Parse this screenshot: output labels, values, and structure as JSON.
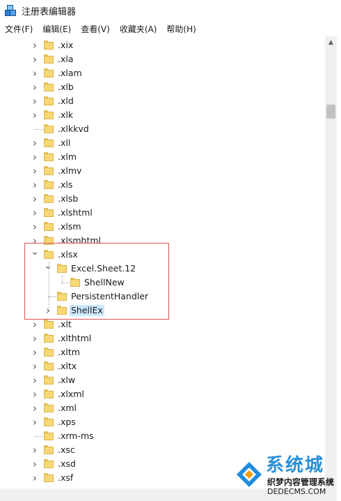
{
  "window": {
    "title": "注册表编辑器"
  },
  "menu": [
    {
      "label": "文件(F)"
    },
    {
      "label": "编辑(E)"
    },
    {
      "label": "查看(V)"
    },
    {
      "label": "收藏夹(A)"
    },
    {
      "label": "帮助(H)"
    }
  ],
  "tree": {
    "rows": [
      {
        "label": ".xix",
        "level": 0,
        "expander": "collapsed"
      },
      {
        "label": ".xla",
        "level": 0,
        "expander": "collapsed"
      },
      {
        "label": ".xlam",
        "level": 0,
        "expander": "collapsed"
      },
      {
        "label": ".xlb",
        "level": 0,
        "expander": "collapsed"
      },
      {
        "label": ".xld",
        "level": 0,
        "expander": "collapsed"
      },
      {
        "label": ".xlk",
        "level": 0,
        "expander": "collapsed"
      },
      {
        "label": ".xlkkvd",
        "level": 0,
        "expander": "none"
      },
      {
        "label": ".xll",
        "level": 0,
        "expander": "collapsed"
      },
      {
        "label": ".xlm",
        "level": 0,
        "expander": "collapsed"
      },
      {
        "label": ".xlmv",
        "level": 0,
        "expander": "collapsed"
      },
      {
        "label": ".xls",
        "level": 0,
        "expander": "collapsed"
      },
      {
        "label": ".xlsb",
        "level": 0,
        "expander": "collapsed"
      },
      {
        "label": ".xlshtml",
        "level": 0,
        "expander": "collapsed"
      },
      {
        "label": ".xlsm",
        "level": 0,
        "expander": "collapsed"
      },
      {
        "label": ".xlsmhtml",
        "level": 0,
        "expander": "collapsed"
      },
      {
        "label": ".xlsx",
        "level": 0,
        "expander": "expanded"
      },
      {
        "label": "Excel.Sheet.12",
        "level": 1,
        "expander": "expanded"
      },
      {
        "label": "ShellNew",
        "level": 2,
        "expander": "none"
      },
      {
        "label": "PersistentHandler",
        "level": 1,
        "expander": "none"
      },
      {
        "label": "ShellEx",
        "level": 1,
        "expander": "collapsed",
        "selected": true
      },
      {
        "label": ".xlt",
        "level": 0,
        "expander": "collapsed"
      },
      {
        "label": ".xlthtml",
        "level": 0,
        "expander": "collapsed"
      },
      {
        "label": ".xltm",
        "level": 0,
        "expander": "collapsed"
      },
      {
        "label": ".xltx",
        "level": 0,
        "expander": "collapsed"
      },
      {
        "label": ".xlw",
        "level": 0,
        "expander": "collapsed"
      },
      {
        "label": ".xlxml",
        "level": 0,
        "expander": "collapsed"
      },
      {
        "label": ".xml",
        "level": 0,
        "expander": "collapsed"
      },
      {
        "label": ".xps",
        "level": 0,
        "expander": "collapsed"
      },
      {
        "label": ".xrm-ms",
        "level": 0,
        "expander": "none"
      },
      {
        "label": ".xsc",
        "level": 0,
        "expander": "collapsed"
      },
      {
        "label": ".xsd",
        "level": 0,
        "expander": "collapsed"
      },
      {
        "label": ".xsf",
        "level": 0,
        "expander": "collapsed"
      }
    ]
  },
  "watermark": {
    "big_text": "系统城",
    "line1": "织梦内容管理系统",
    "line2": "DEDECMS.COM"
  },
  "colors": {
    "selection": "#cce8ff",
    "highlight_border": "#d9534f",
    "folder": "#f8d775"
  }
}
